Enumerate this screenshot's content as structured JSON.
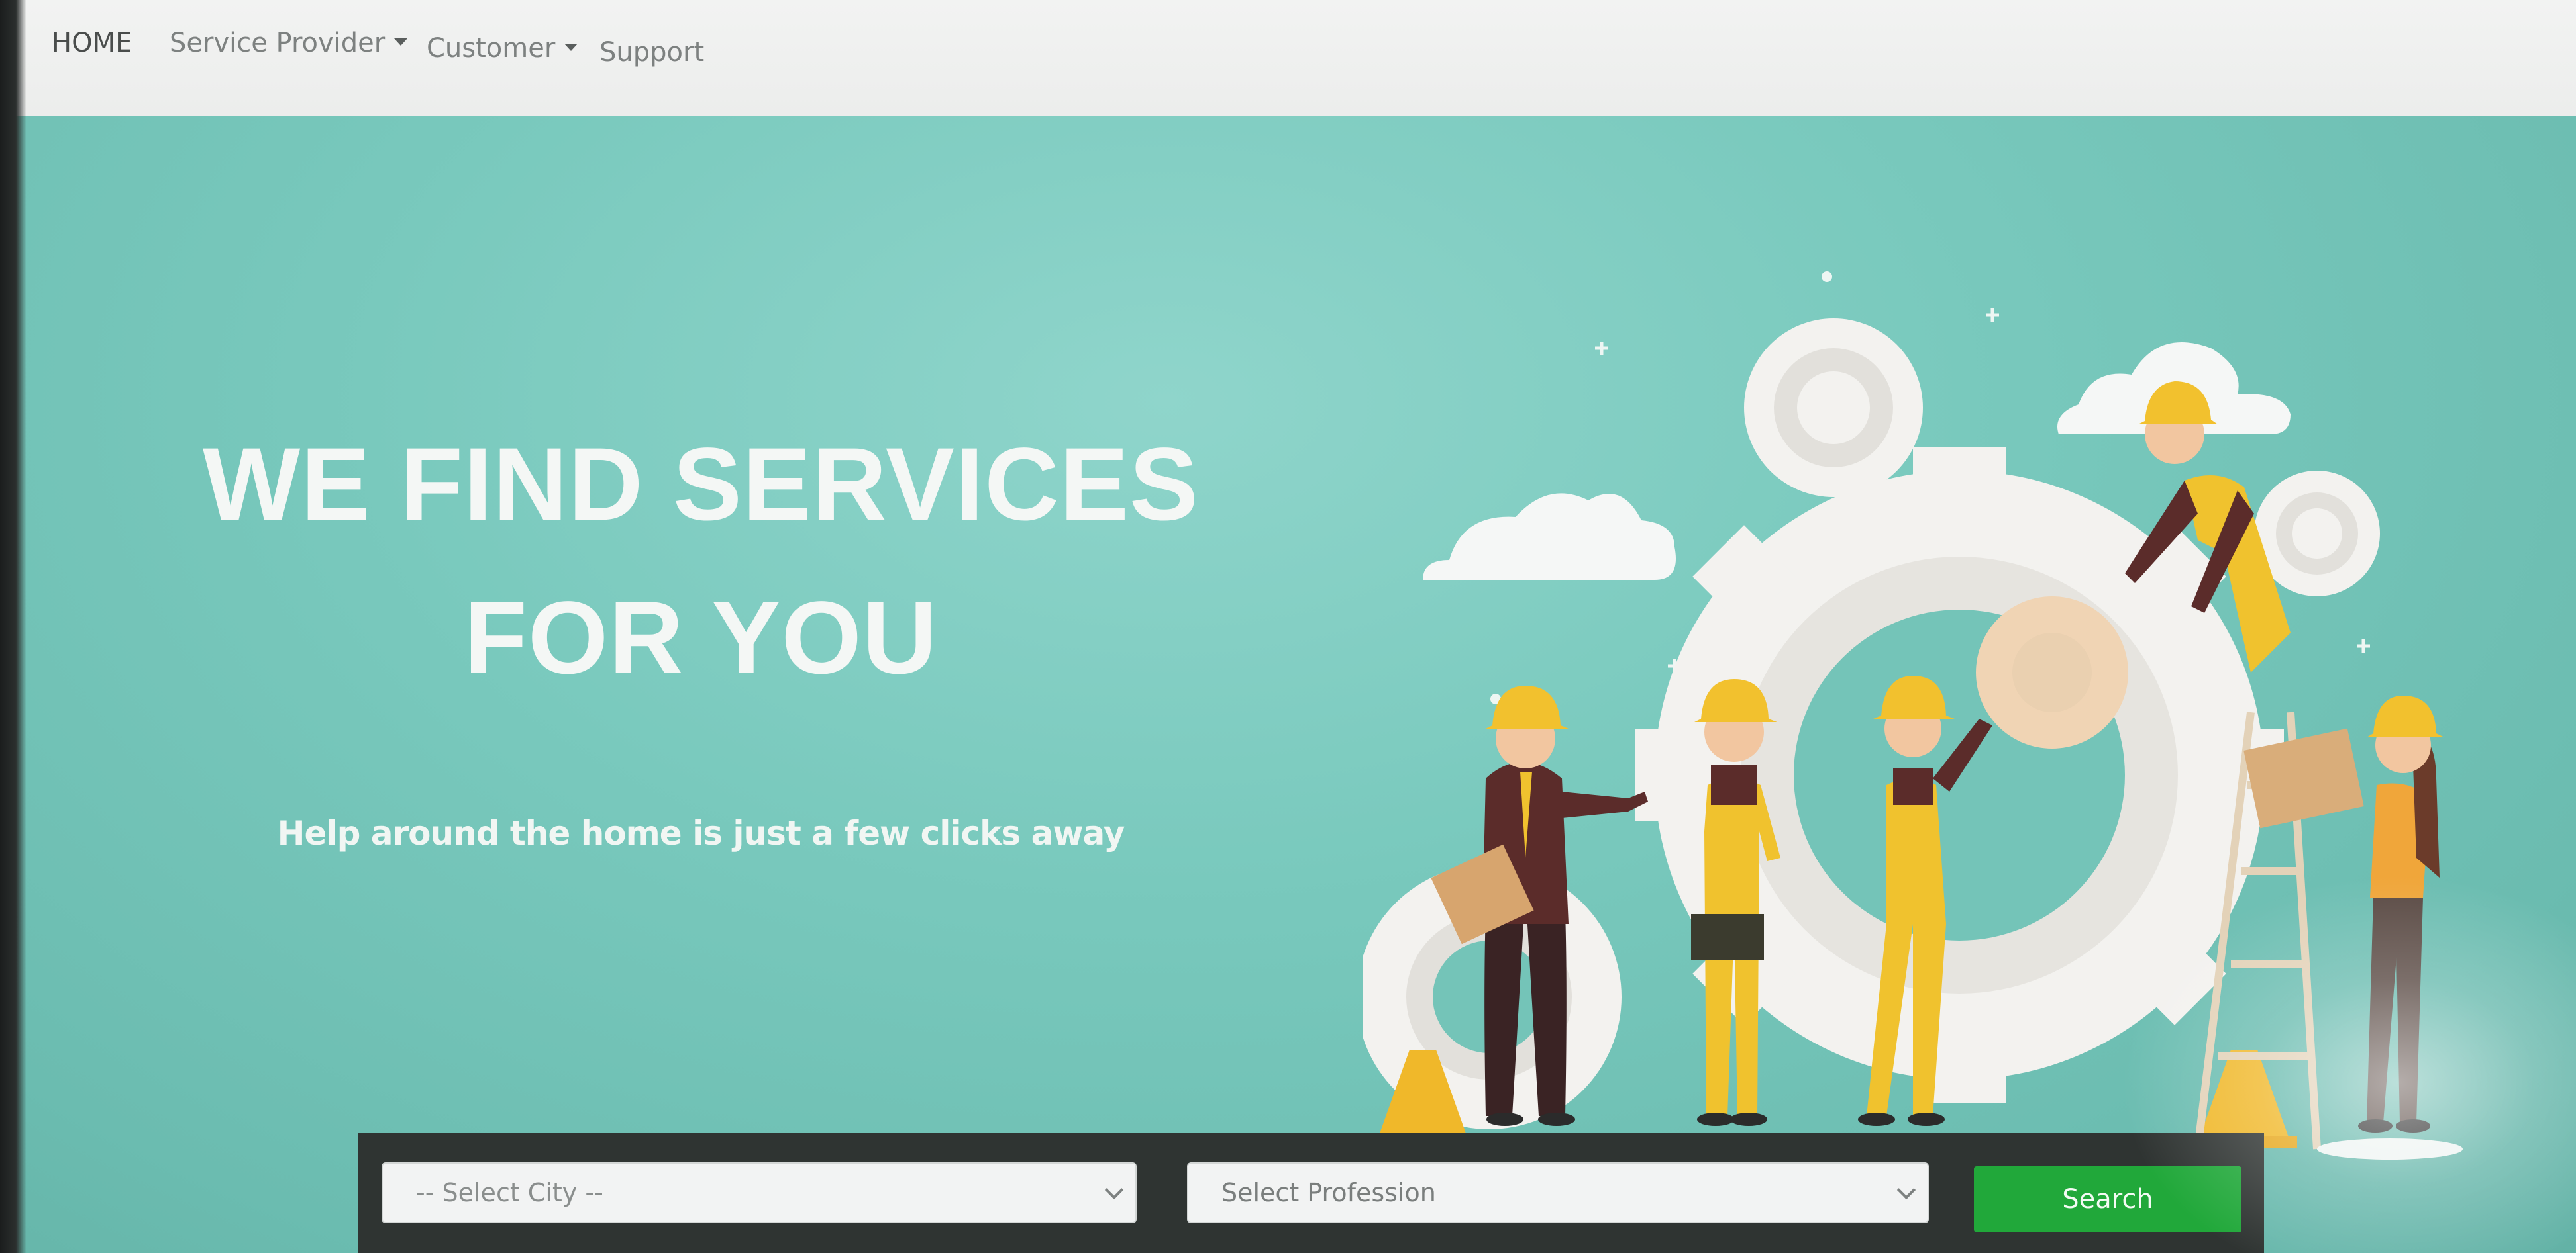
{
  "nav": {
    "home": "HOME",
    "service_provider": "Service Provider",
    "customer": "Customer",
    "support": "Support"
  },
  "hero": {
    "title_line1": "WE FIND SERVICES",
    "title_line2": "FOR YOU",
    "subtitle": "Help around the home is just a few clicks away"
  },
  "search": {
    "city_selected": "-- Select City --",
    "profession_selected": "Select Profession",
    "button_label": "Search"
  },
  "colors": {
    "hero_bg": "#79c9bd",
    "button_green": "#21a83a",
    "search_bar_bg": "#2f3432",
    "helmet_yellow": "#f2c12e"
  },
  "icons": {
    "dropdown": "caret-down-icon",
    "select_chevron": "chevron-down-icon",
    "illustration": "workers-with-gears-illustration"
  }
}
